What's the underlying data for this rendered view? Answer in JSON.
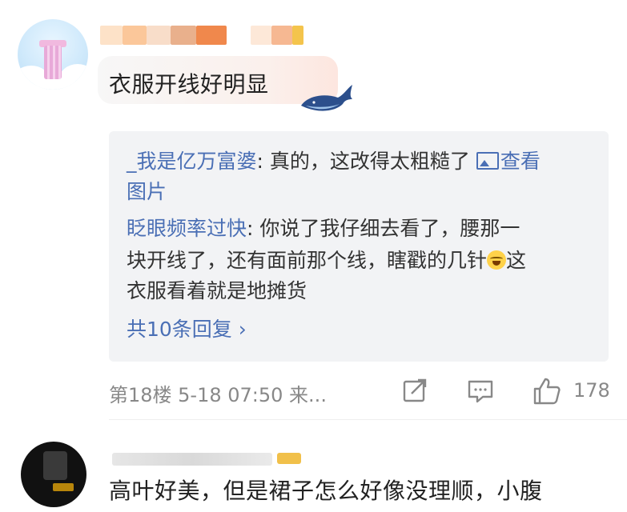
{
  "comment1": {
    "text": "衣服开线好明显",
    "replies": [
      {
        "name": "_我是亿万富婆",
        "lines": [
          "真的，这改得太粗糙了 ",
          "图片"
        ],
        "image_link_label": "查看"
      },
      {
        "name": "眨眼频率过快",
        "lines": [
          "你说了我仔细去看了，腰那一",
          "块开线了，还有面前那个线，瞎戳的几针",
          "这",
          "衣服看着就是地摊货"
        ]
      }
    ],
    "more_replies": "共10条回复 ›",
    "meta": "第18楼  5-18 07:50  来...",
    "like_count": "178"
  },
  "comment2": {
    "text": "高叶好美，但是裙子怎么好像没理顺，小腹"
  },
  "icons": {
    "share": "share-icon",
    "reply": "reply-icon",
    "like": "like-icon",
    "image": "image-icon",
    "emoji": "laugh-cry-emoji-icon"
  },
  "colors": {
    "link": "#4a6fb5",
    "meta": "#888888",
    "reply_bg": "#f2f3f5"
  }
}
